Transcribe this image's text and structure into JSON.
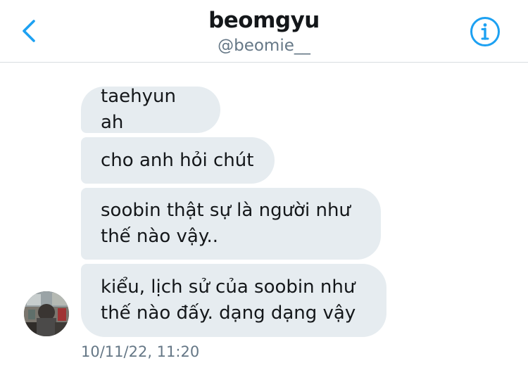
{
  "header": {
    "title": "beomgyu",
    "handle": "@beomie__",
    "back_icon": "chevron-left-icon",
    "info_icon": "info-circle-icon",
    "accent_color": "#1da1f2"
  },
  "conversation": {
    "messages": [
      {
        "text": "taehyun ah"
      },
      {
        "text": "cho anh hỏi chút"
      },
      {
        "text": "soobin thật sự là người như thế nào vậy.."
      },
      {
        "text": "kiểu, lịch sử của soobin như thế nào đấy. dạng dạng vậy"
      }
    ],
    "timestamp": "10/11/22, 11:20",
    "bubble_color": "#e6ecf0",
    "text_color": "#14171a",
    "meta_color": "#657786"
  }
}
